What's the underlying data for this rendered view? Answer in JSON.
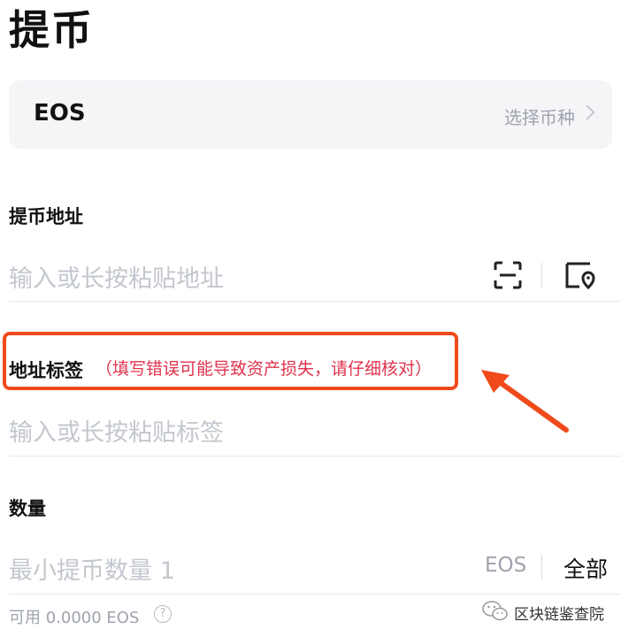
{
  "title": "提币",
  "coin": {
    "selected": "EOS",
    "select_hint": "选择币种"
  },
  "address": {
    "label": "提币地址",
    "placeholder": "输入或长按粘贴地址"
  },
  "memo": {
    "label": "地址标签",
    "warning": "（填写错误可能导致资产损失，请仔细核对）",
    "placeholder": "输入或长按粘贴标签"
  },
  "amount": {
    "label": "数量",
    "placeholder": "最小提币数量 1",
    "unit": "EOS",
    "all_button": "全部",
    "available": "可用 0.0000 EOS"
  },
  "help_glyph": "?",
  "watermark": {
    "text": "区块链鉴查院"
  },
  "colors": {
    "highlight_box": "#f04a1a",
    "warning_text": "#e0334d",
    "placeholder": "#c3c7ce"
  }
}
